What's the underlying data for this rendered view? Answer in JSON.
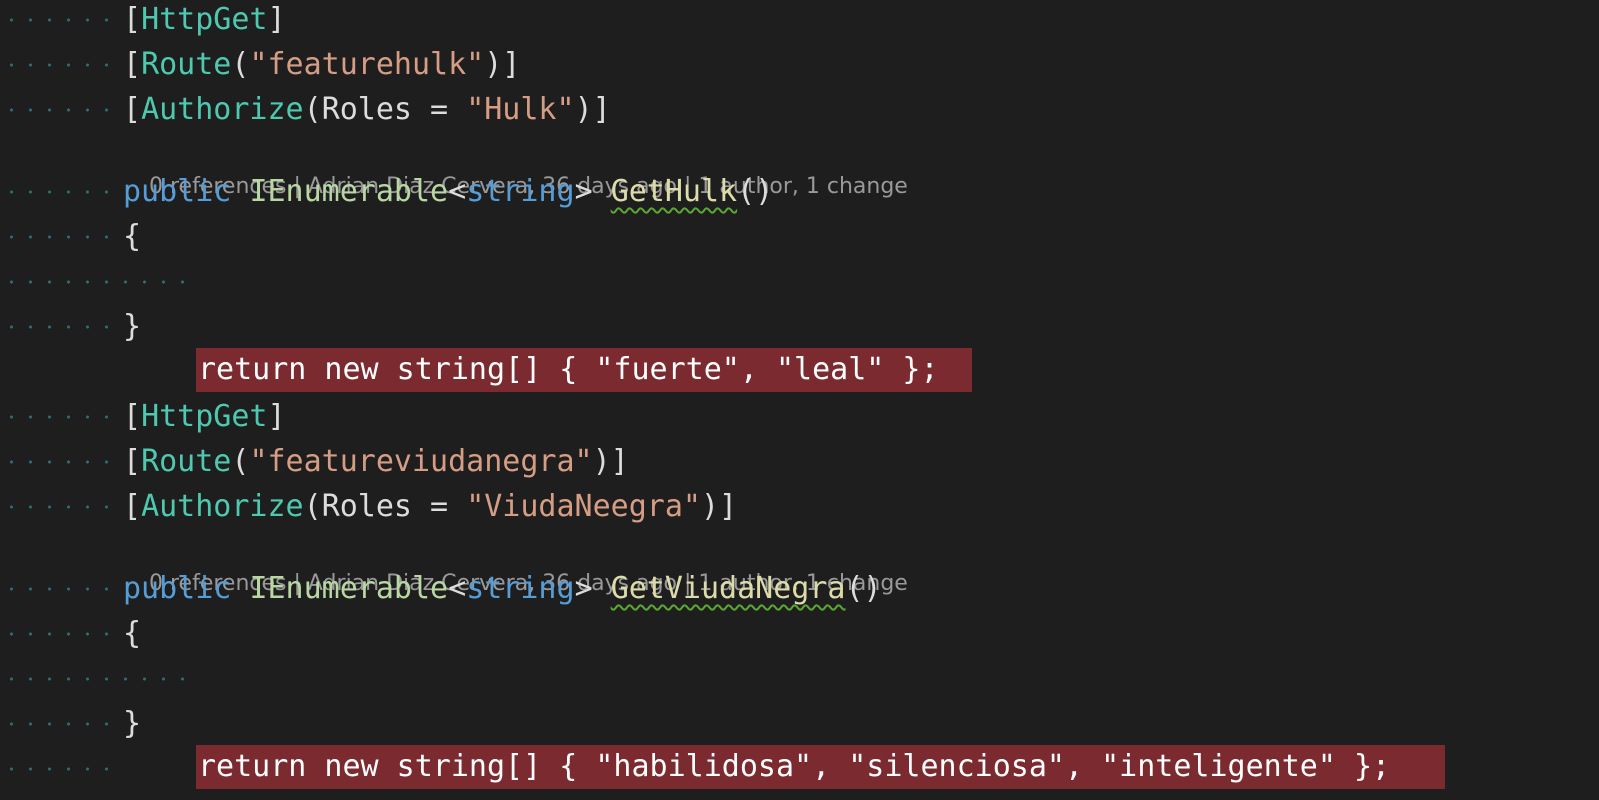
{
  "methods": [
    {
      "attributes": {
        "http": "HttpGet",
        "route_name": "Route",
        "route_value": "\"featurehulk\"",
        "authorize_name": "Authorize",
        "roles_param": "Roles",
        "roles_value": "\"Hulk\""
      },
      "codelens": {
        "references": "0 references",
        "author": "Adrian Diaz Cervera, 36 days ago",
        "changes": "1 author, 1 change"
      },
      "signature": {
        "modifier": "public",
        "return_type": "IEnumerable",
        "generic_arg": "string",
        "name": "GetHulk",
        "params": "()"
      },
      "open_brace": "{",
      "body": {
        "statement_start": "return new string[] { ",
        "values": [
          "\"fuerte\"",
          "\"leal\""
        ],
        "statement_end": " };"
      },
      "close_brace": "}"
    },
    {
      "attributes": {
        "http": "HttpGet",
        "route_name": "Route",
        "route_value": "\"featureviudanegra\"",
        "authorize_name": "Authorize",
        "roles_param": "Roles",
        "roles_value": "\"ViudaNeegra\""
      },
      "codelens": {
        "references": "0 references",
        "author": "Adrian Diaz Cervera, 36 days ago",
        "changes": "1 author, 1 change"
      },
      "signature": {
        "modifier": "public",
        "return_type": "IEnumerable",
        "generic_arg": "string",
        "name": "GetViudaNegra",
        "params": "()"
      },
      "open_brace": "{",
      "body": {
        "statement_start": "return new string[] { ",
        "values": [
          "\"habilidosa\"",
          "\"silenciosa\"",
          "\"inteligente\""
        ],
        "statement_end": " };"
      },
      "close_brace": "}"
    }
  ],
  "colors": {
    "background": "#1e1e1e",
    "keyword": "#569cd6",
    "type": "#4ec9b0",
    "string": "#d69d85",
    "method": "#dcdcaa",
    "breakpoint_highlight": "#7b2a2f"
  }
}
